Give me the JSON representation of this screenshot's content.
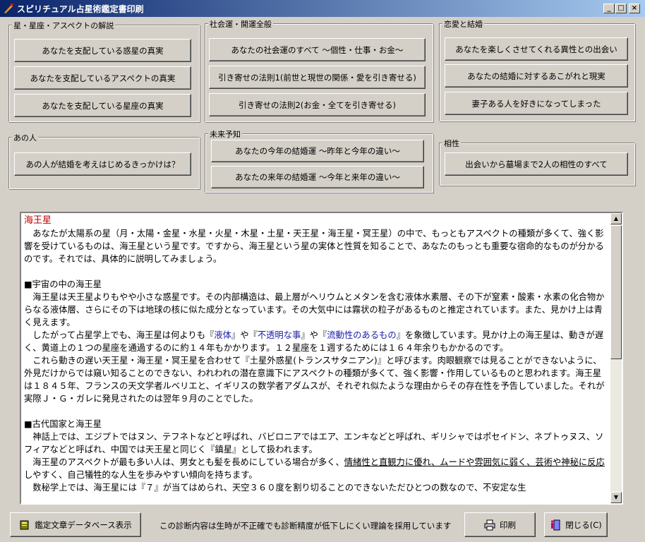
{
  "window": {
    "title": "スピリチュアル占星術鑑定書印刷"
  },
  "groups": {
    "stars": {
      "label": "星・星座・アスペクトの解説",
      "buttons": [
        "あなたを支配している惑星の真実",
        "あなたを支配しているアスペクトの真実",
        "あなたを支配している星座の真実"
      ]
    },
    "social": {
      "label": "社会運・開運全般",
      "buttons": [
        "あなたの社会運のすべて ～個性・仕事・お金～",
        "引き寄せの法則1(前世と現世の関係・愛を引き寄せる)",
        "引き寄せの法則2(お金・全てを引き寄せる)"
      ]
    },
    "love": {
      "label": "恋愛と結婚",
      "buttons": [
        "あなたを楽しくさせてくれる異性との出会い",
        "あなたの結婚に対するあこがれと現実",
        "妻子ある人を好きになってしまった"
      ]
    },
    "person": {
      "label": "あの人",
      "buttons": [
        "あの人が結婚を考えはじめるきっかけは？"
      ]
    },
    "future": {
      "label": "未来予知",
      "buttons": [
        "あなたの今年の結婚運 ～昨年と今年の違い～",
        "あなたの来年の結婚運 ～今年と来年の違い～"
      ]
    },
    "compat": {
      "label": "相性",
      "buttons": [
        "出会いから墓場まで2人の相性のすべて"
      ]
    }
  },
  "content": {
    "title": "海王星",
    "p1": "　あなたが太陽系の星（月・太陽・金星・水星・火星・木星・土星・天王星・海王星・冥王星）の中で、もっともアスペクトの種類が多くて、強く影響を受けているものは、海王星という星です。ですから、海王星という星の実体と性質を知ることで、あなたのもっとも重要な宿命的なものが分かるのです。それでは、具体的に説明してみましょう。",
    "h1": "■宇宙の中の海王星",
    "p2": "　海王星は天王星よりもやや小さな惑星です。その内部構造は、最上層がヘリウムとメタンを含む液体水素層、その下が窒素・酸素・水素の化合物からなる液体層、さらにその下は地球の核に似た成分となっています。その大気中には霧状の粒子があるものと推定されています。また、見かけ上は青く見えます。",
    "p3a": "　したがって占星学上でも、海王星は何よりも『",
    "p3b1": "液体",
    "p3c": "』や『",
    "p3b2": "不透明な事",
    "p3d": "』や『",
    "p3b3": "流動性のあるもの",
    "p3e": "』を象徴しています。見かけ上の海王星は、動きが遅く、黄道上の１つの星座を通過するのに約１４年もかかります。１２星座を１週するためには１６４年余りもかかるのです。",
    "p4": "　これら動きの遅い天王星・海王星・冥王星を合わせて『土星外惑星(トランスサタニアン)』と呼びます。肉眼観察では見ることができないように、外見だけからでは窺い知ることのできない、われわれの潜在意識下にアスペクトの種類が多くて、強く影響・作用しているものと思われます。海王星は１８４５年、フランスの天文学者ルベリエと、イギリスの数学者アダムスが、それぞれ似たような理由からその存在性を予告していました。それが実際Ｊ・Ｇ・ガレに発見されたのは翌年９月のことでした。",
    "h2": "■古代国家と海王星",
    "p5": "　神話上では、エジプトではヌン、テフネトなどと呼ばれ、バビロニアではエア、エンキなどと呼ばれ、ギリシャではポセイドン、ネプトゥヌス、ソフィアなどと呼ばれ、中国では天王星と同じく『鎮星』として扱われます。",
    "p6a": "　海王星のアスペクトが最も多い人は、男女とも髪を長めにしている場合が多く、",
    "p6b": "情緒性と直観力に優れ、ムードや雰囲気に弱く、芸術や神秘に反応",
    "p6c": "しやすく、自己犠牲的な人生を歩みやすい傾向を持ちます。",
    "p7": "　数秘学上では、海王星には『７』が当てはめられ、天空３６０度を割り切ることのできないただひとつの数なので、不安定な生"
  },
  "bottom": {
    "db_button": "鑑定文章データベース表示",
    "notice": "この診断内容は生時が不正確でも診断精度が低下しにくい理論を採用しています",
    "print_button": "印刷",
    "close_button": "閉じる(C)"
  }
}
